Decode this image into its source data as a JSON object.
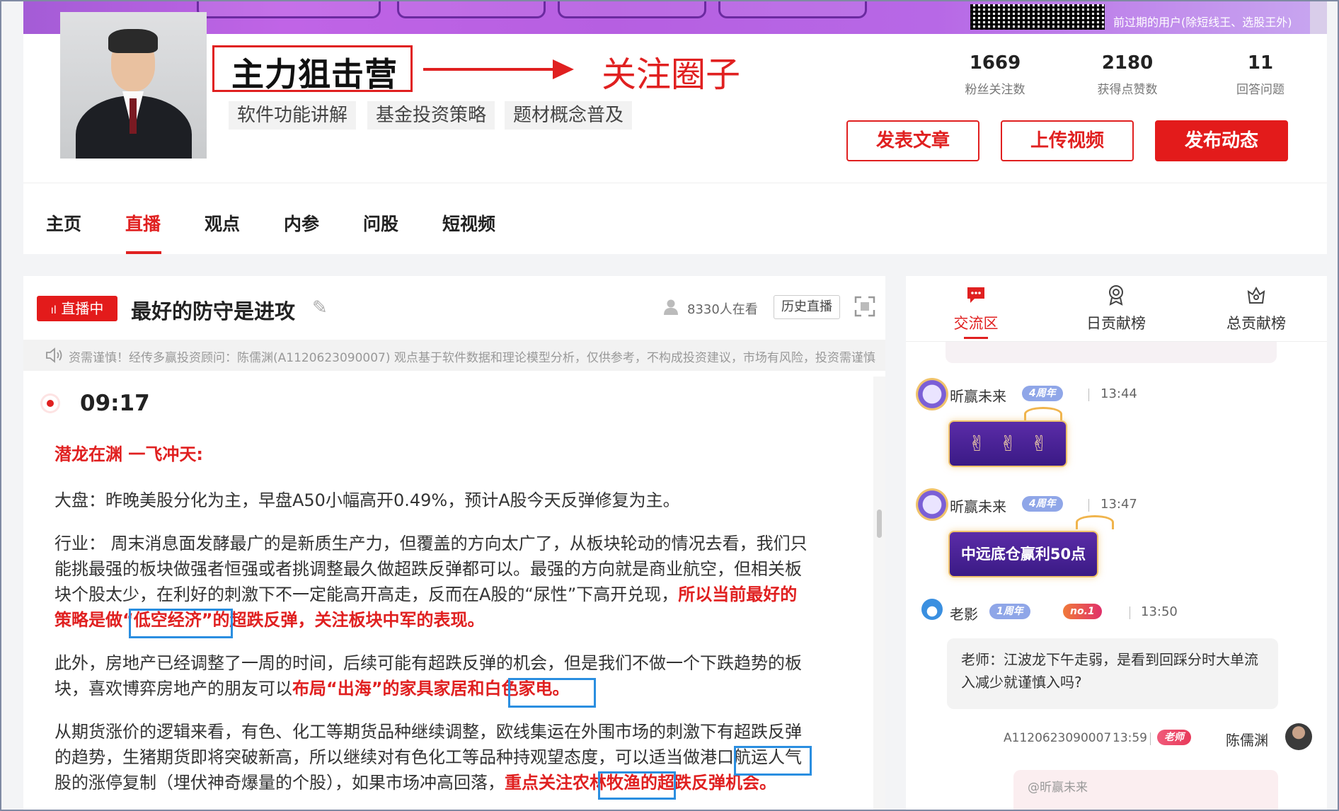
{
  "banner": {
    "note": "前过期的用户(除短线王、选股王外)"
  },
  "profile": {
    "title": "主力狙击营",
    "annotation_label": "关注圈子",
    "tags": [
      "软件功能讲解",
      "基金投资策略",
      "题材概念普及"
    ],
    "stats": [
      {
        "value": "1669",
        "label": "粉丝关注数"
      },
      {
        "value": "2180",
        "label": "获得点赞数"
      },
      {
        "value": "11",
        "label": "回答问题"
      }
    ],
    "buttons": {
      "article": "发表文章",
      "video": "上传视频",
      "post": "发布动态"
    }
  },
  "tabs": [
    "主页",
    "直播",
    "观点",
    "内参",
    "问股",
    "短视频"
  ],
  "active_tab": "直播",
  "live": {
    "badge": "直播中",
    "title": "最好的防守是进攻",
    "viewers": "8330人在看",
    "history_button": "历史直播",
    "notice": "资需谨慎！经传多赢投资顾问：陈儒渊(A1120623090007) 观点基于软件数据和理论模型分析，仅供参考，不构成投资建议，市场有风险，投资需谨慎！",
    "post_time": "09:17",
    "heading": "潜龙在渊 一飞冲天:",
    "para1": "大盘：昨晚美股分化为主，早盘A50小幅高开0.49%，预计A股今天反弹修复为主。",
    "para2_line1": "行业： 周末消息面发酵最广的是新质生产力，但覆盖的方向太广了，从板块轮动的情况去看，我们只",
    "para2_line2": "能挑最强的板块做强者恒强或者挑调整最久做超跌反弹都可以。最强的方向就是商业航空，但相关板",
    "para2_line3_plain": "块个股太少，在利好的刺激下不一定能高开高走，反而在A股的“尿性”下高开兑现，",
    "para2_line3_red": "所以当前最好的",
    "para2_line4_red": "策略是做“低空经济”的超跌反弹，关注板块中军的表现。",
    "para3_line1": "此外，房地产已经调整了一周的时间，后续可能有超跌反弹的机会，但是我们不做一个下跌趋势的板",
    "para3_line2_plain": "块，喜欢博弈房地产的朋友可以",
    "para3_line2_red": "布局“出海”的家具家居和白色家电。",
    "para4_line1": "从期货涨价的逻辑来看，有色、化工等期货品种继续调整，欧线集运在外围市场的刺激下有超跌反弹",
    "para4_line2": "的趋势，生猪期货即将突破新高，所以继续对有色化工等品种持观望态度，可以适当做港口航运人气",
    "para4_line3_plain": "股的涨停复制（埋伏神奇爆量的个股），如果市场冲高回落，",
    "para4_line3_red": "重点关注农林牧渔的超跌反弹机会。"
  },
  "chat": {
    "tabs": [
      "交流区",
      "日贡献榜",
      "总贡献榜"
    ],
    "messages": [
      {
        "name": "昕赢未来",
        "badge": "4周年",
        "time": "13:44",
        "sticker": ""
      },
      {
        "name": "昕赢未来",
        "badge": "4周年",
        "time": "13:47",
        "sticker": "中远底仓赢利50点"
      },
      {
        "name": "老影",
        "badge": "1周年",
        "badge2": "no.1",
        "time": "13:50",
        "text": "老师：江波龙下午走弱，是看到回踩分时大单流入减少就谨慎入吗?"
      }
    ],
    "teacher": {
      "id": "A1120623090007",
      "time": "13:59",
      "badge": "老师",
      "name": "陈儒渊"
    },
    "reply_quote": "@昕赢未来"
  },
  "colors": {
    "accent": "#e02020",
    "highlight_box": "#2a8ee0",
    "badge_blue": "#8fa6e8"
  }
}
